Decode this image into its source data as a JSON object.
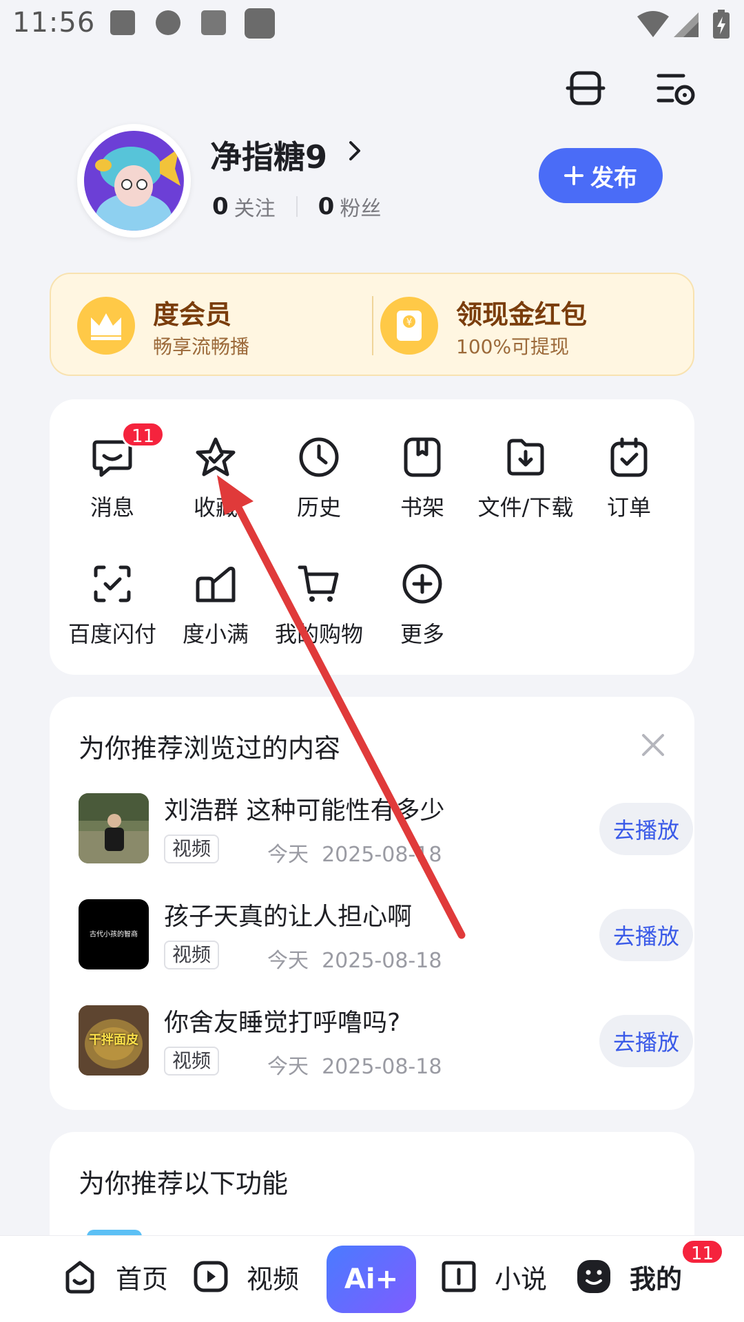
{
  "status_bar": {
    "time": "11:56"
  },
  "profile": {
    "username": "净指糖9",
    "following_count": "0",
    "following_label": "关注",
    "followers_count": "0",
    "followers_label": "粉丝",
    "publish_label": "发布"
  },
  "vip": {
    "left_title": "度会员",
    "left_sub": "畅享流畅播",
    "right_title": "领现金红包",
    "right_sub": "100%可提现"
  },
  "grid": {
    "items": [
      {
        "label": "消息",
        "icon": "message-icon",
        "badge": "11"
      },
      {
        "label": "收藏",
        "icon": "star-icon"
      },
      {
        "label": "历史",
        "icon": "clock-icon"
      },
      {
        "label": "书架",
        "icon": "bookshelf-icon"
      },
      {
        "label": "文件/下载",
        "icon": "download-folder-icon"
      },
      {
        "label": "订单",
        "icon": "order-icon"
      },
      {
        "label": "百度闪付",
        "icon": "scan-pay-icon"
      },
      {
        "label": "度小满",
        "icon": "duxiaoman-icon"
      },
      {
        "label": "我的购物",
        "icon": "cart-icon"
      },
      {
        "label": "更多",
        "icon": "plus-circle-icon"
      }
    ]
  },
  "recommend": {
    "title": "为你推荐浏览过的内容",
    "items": [
      {
        "title": "刘浩群 这种可能性有多少",
        "tag": "视频",
        "day": "今天",
        "date": "2025-08-18",
        "action": "去播放"
      },
      {
        "title": "孩子天真的让人担心啊",
        "tag": "视频",
        "day": "今天",
        "date": "2025-08-18",
        "action": "去播放",
        "thumb_text": "古代小孩的智商"
      },
      {
        "title": "你舍友睡觉打呼噜吗?",
        "tag": "视频",
        "day": "今天",
        "date": "2025-08-18",
        "action": "去播放",
        "thumb_text": "干拌面皮"
      }
    ]
  },
  "features": {
    "title": "为你推荐以下功能"
  },
  "bottom_nav": {
    "home": "首页",
    "video": "视频",
    "ai": "Ai+",
    "novel": "小说",
    "mine": "我的",
    "mine_badge": "11"
  },
  "colors": {
    "accent": "#4a6cf7",
    "badge": "#f5233d",
    "annotation_arrow": "#e03a3a"
  }
}
